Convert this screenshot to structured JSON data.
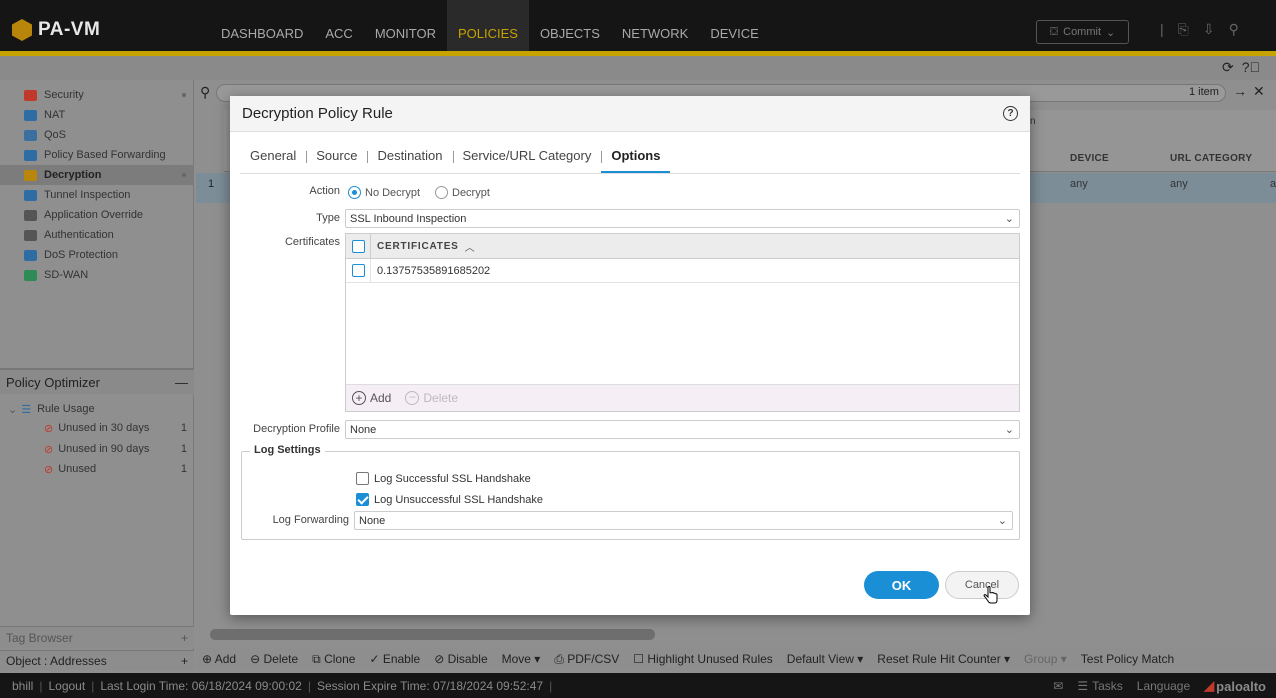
{
  "app": {
    "logo_text": "PA-VM"
  },
  "nav": {
    "items": [
      "DASHBOARD",
      "ACC",
      "MONITOR",
      "POLICIES",
      "OBJECTS",
      "NETWORK",
      "DEVICE"
    ],
    "active": "POLICIES"
  },
  "commit_label": "Commit",
  "sidebar": {
    "items": [
      {
        "label": "Security",
        "icon": "security-icon",
        "color": "#c0392b"
      },
      {
        "label": "NAT",
        "icon": "nat-icon",
        "color": "#2e6da4"
      },
      {
        "label": "QoS",
        "icon": "qos-icon",
        "color": "#3b6fa0"
      },
      {
        "label": "Policy Based Forwarding",
        "icon": "pbf-icon",
        "color": "#2e6da4"
      },
      {
        "label": "Decryption",
        "icon": "decryption-icon",
        "color": "#b8860b"
      },
      {
        "label": "Tunnel Inspection",
        "icon": "tunnel-icon",
        "color": "#2e6da4"
      },
      {
        "label": "Application Override",
        "icon": "app-override-icon",
        "color": "#555"
      },
      {
        "label": "Authentication",
        "icon": "authentication-icon",
        "color": "#555"
      },
      {
        "label": "DoS Protection",
        "icon": "dos-icon",
        "color": "#2e6da4"
      },
      {
        "label": "SD-WAN",
        "icon": "sdwan-icon",
        "color": "#2e8b57"
      }
    ],
    "active": "Decryption"
  },
  "optimizer": {
    "title": "Policy Optimizer",
    "rule_usage": "Rule Usage",
    "rows": [
      {
        "label": "Unused in 30 days",
        "count": "1"
      },
      {
        "label": "Unused in 90 days",
        "count": "1"
      },
      {
        "label": "Unused",
        "count": "1"
      }
    ]
  },
  "tag_browser": "Tag Browser",
  "objects_addresses": "Object : Addresses",
  "table": {
    "item_count": "1 item",
    "columns": [
      "DEVICE",
      "URL CATEGORY"
    ],
    "partial_header": "n",
    "row_num": "1",
    "row_values": [
      "any",
      "any",
      "a"
    ]
  },
  "bottom_toolbar": [
    "Add",
    "Delete",
    "Clone",
    "Enable",
    "Disable",
    "Move",
    "PDF/CSV",
    "Highlight Unused Rules",
    "Default View",
    "Reset Rule Hit Counter",
    "Group",
    "Test Policy Match"
  ],
  "status": {
    "user": "bhill",
    "logout": "Logout",
    "last_login": "Last Login Time: 06/18/2024 09:00:02",
    "session_expire": "Session Expire Time: 07/18/2024 09:52:47",
    "tasks": "Tasks",
    "language": "Language",
    "brand": "paloalto"
  },
  "modal": {
    "title": "Decryption Policy Rule",
    "tabs": [
      "General",
      "Source",
      "Destination",
      "Service/URL Category",
      "Options"
    ],
    "active_tab": "Options",
    "action_label": "Action",
    "action_options": [
      "No Decrypt",
      "Decrypt"
    ],
    "action_selected": "No Decrypt",
    "type_label": "Type",
    "type_value": "SSL Inbound Inspection",
    "certificates_label": "Certificates",
    "certificates_header": "CERTIFICATES",
    "certificates": [
      "0.13757535891685202"
    ],
    "add_label": "Add",
    "delete_label": "Delete",
    "decryption_profile_label": "Decryption Profile",
    "decryption_profile_value": "None",
    "log_settings_label": "Log Settings",
    "log_successful_label": "Log Successful SSL Handshake",
    "log_successful_checked": false,
    "log_unsuccessful_label": "Log Unsuccessful SSL Handshake",
    "log_unsuccessful_checked": true,
    "log_forwarding_label": "Log Forwarding",
    "log_forwarding_value": "None",
    "ok_label": "OK",
    "cancel_label": "Cancel"
  },
  "colors": {
    "accent": "#1a8fd6",
    "nav_active": "#c7a300",
    "topbar": "#151515"
  }
}
